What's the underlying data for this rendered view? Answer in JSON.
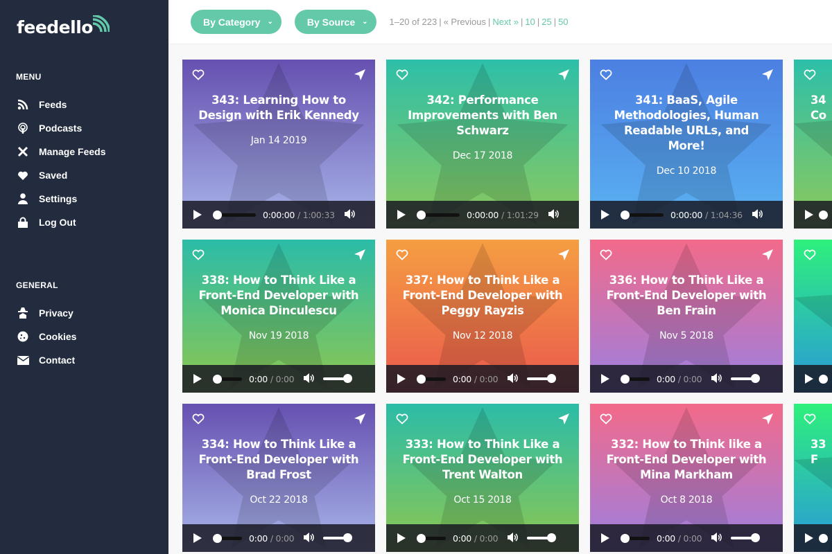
{
  "brand": {
    "name": "feedello"
  },
  "sidebar": {
    "menu_heading": "MENU",
    "menu": [
      {
        "label": "Feeds",
        "icon": "rss-icon"
      },
      {
        "label": "Podcasts",
        "icon": "podcast-icon"
      },
      {
        "label": "Manage Feeds",
        "icon": "tools-icon"
      },
      {
        "label": "Saved",
        "icon": "heart-icon"
      },
      {
        "label": "Settings",
        "icon": "user-icon"
      },
      {
        "label": "Log Out",
        "icon": "lock-icon"
      }
    ],
    "general_heading": "GENERAL",
    "general": [
      {
        "label": "Privacy",
        "icon": "spy-icon"
      },
      {
        "label": "Cookies",
        "icon": "cookie-icon"
      },
      {
        "label": "Contact",
        "icon": "envelope-icon"
      }
    ]
  },
  "toolbar": {
    "by_category": "By Category",
    "by_source": "By Source",
    "pager": {
      "range": "1–20 of 223",
      "previous": "« Previous",
      "next": "Next »",
      "sizes": [
        "10",
        "25",
        "50"
      ]
    }
  },
  "colors": {
    "accent": "#63c9a9",
    "sidebar": "#222c3e"
  },
  "cards": [
    {
      "title": "343: Learning How to Design with Erik Kennedy",
      "date": "Jan 14 2019",
      "current": "0:00:00",
      "total": "1:00:33",
      "grad": [
        "#6650b0",
        "#a9b6ea"
      ],
      "volume": false
    },
    {
      "title": "342: Performance Improvements with Ben Schwarz",
      "date": "Dec 17 2018",
      "current": "0:00:00",
      "total": "1:01:29",
      "grad": [
        "#2dbfa9",
        "#8ec95a"
      ],
      "volume": false
    },
    {
      "title": "341: BaaS, Agile Methodologies, Human Readable URLs, and More!",
      "date": "Dec 10 2018",
      "current": "0:00:00",
      "total": "1:04:36",
      "grad": [
        "#4c7fe2",
        "#5ab3f2"
      ],
      "volume": false
    },
    {
      "title": "34 Co",
      "date": "",
      "current": "",
      "total": "",
      "grad": [
        "#2dbfa9",
        "#8ec95a"
      ],
      "volume": false
    },
    {
      "title": "338: How to Think Like a Front-End Developer with Monica Dinculescu",
      "date": "Nov 19 2018",
      "current": "0:00",
      "total": "0:00",
      "grad": [
        "#2bbca8",
        "#8ec74f"
      ],
      "volume": true
    },
    {
      "title": "337: How to Think Like a Front-End Developer with Peggy Rayzis",
      "date": "Nov 12 2018",
      "current": "0:00",
      "total": "0:00",
      "grad": [
        "#f59e42",
        "#e9584c"
      ],
      "volume": true
    },
    {
      "title": "336: How to Think Like a Front-End Developer with Ben Frain",
      "date": "Nov 5 2018",
      "current": "0:00",
      "total": "0:00",
      "grad": [
        "#f36a8a",
        "#9a80e2"
      ],
      "volume": true
    },
    {
      "title": "",
      "date": "",
      "current": "",
      "total": "",
      "grad": [
        "#2ef07c",
        "#2a98da"
      ],
      "volume": true
    },
    {
      "title": "334: How to Think Like a Front-End Developer with Brad Frost",
      "date": "Oct 22 2018",
      "current": "0:00",
      "total": "0:00",
      "grad": [
        "#6650b0",
        "#a9b6ea"
      ],
      "volume": true
    },
    {
      "title": "333: How to Think Like a Front-End Developer with Trent Walton",
      "date": "Oct 15 2018",
      "current": "0:00",
      "total": "0:00",
      "grad": [
        "#2bbca8",
        "#8ec74f"
      ],
      "volume": true
    },
    {
      "title": "332: How to Think like a Front-End Developer with Mina Markham",
      "date": "Oct 8 2018",
      "current": "0:00",
      "total": "0:00",
      "grad": [
        "#f36a8a",
        "#9a80e2"
      ],
      "volume": true
    },
    {
      "title": "33 F",
      "date": "",
      "current": "",
      "total": "",
      "grad": [
        "#2ef07c",
        "#2a98da"
      ],
      "volume": true
    }
  ]
}
